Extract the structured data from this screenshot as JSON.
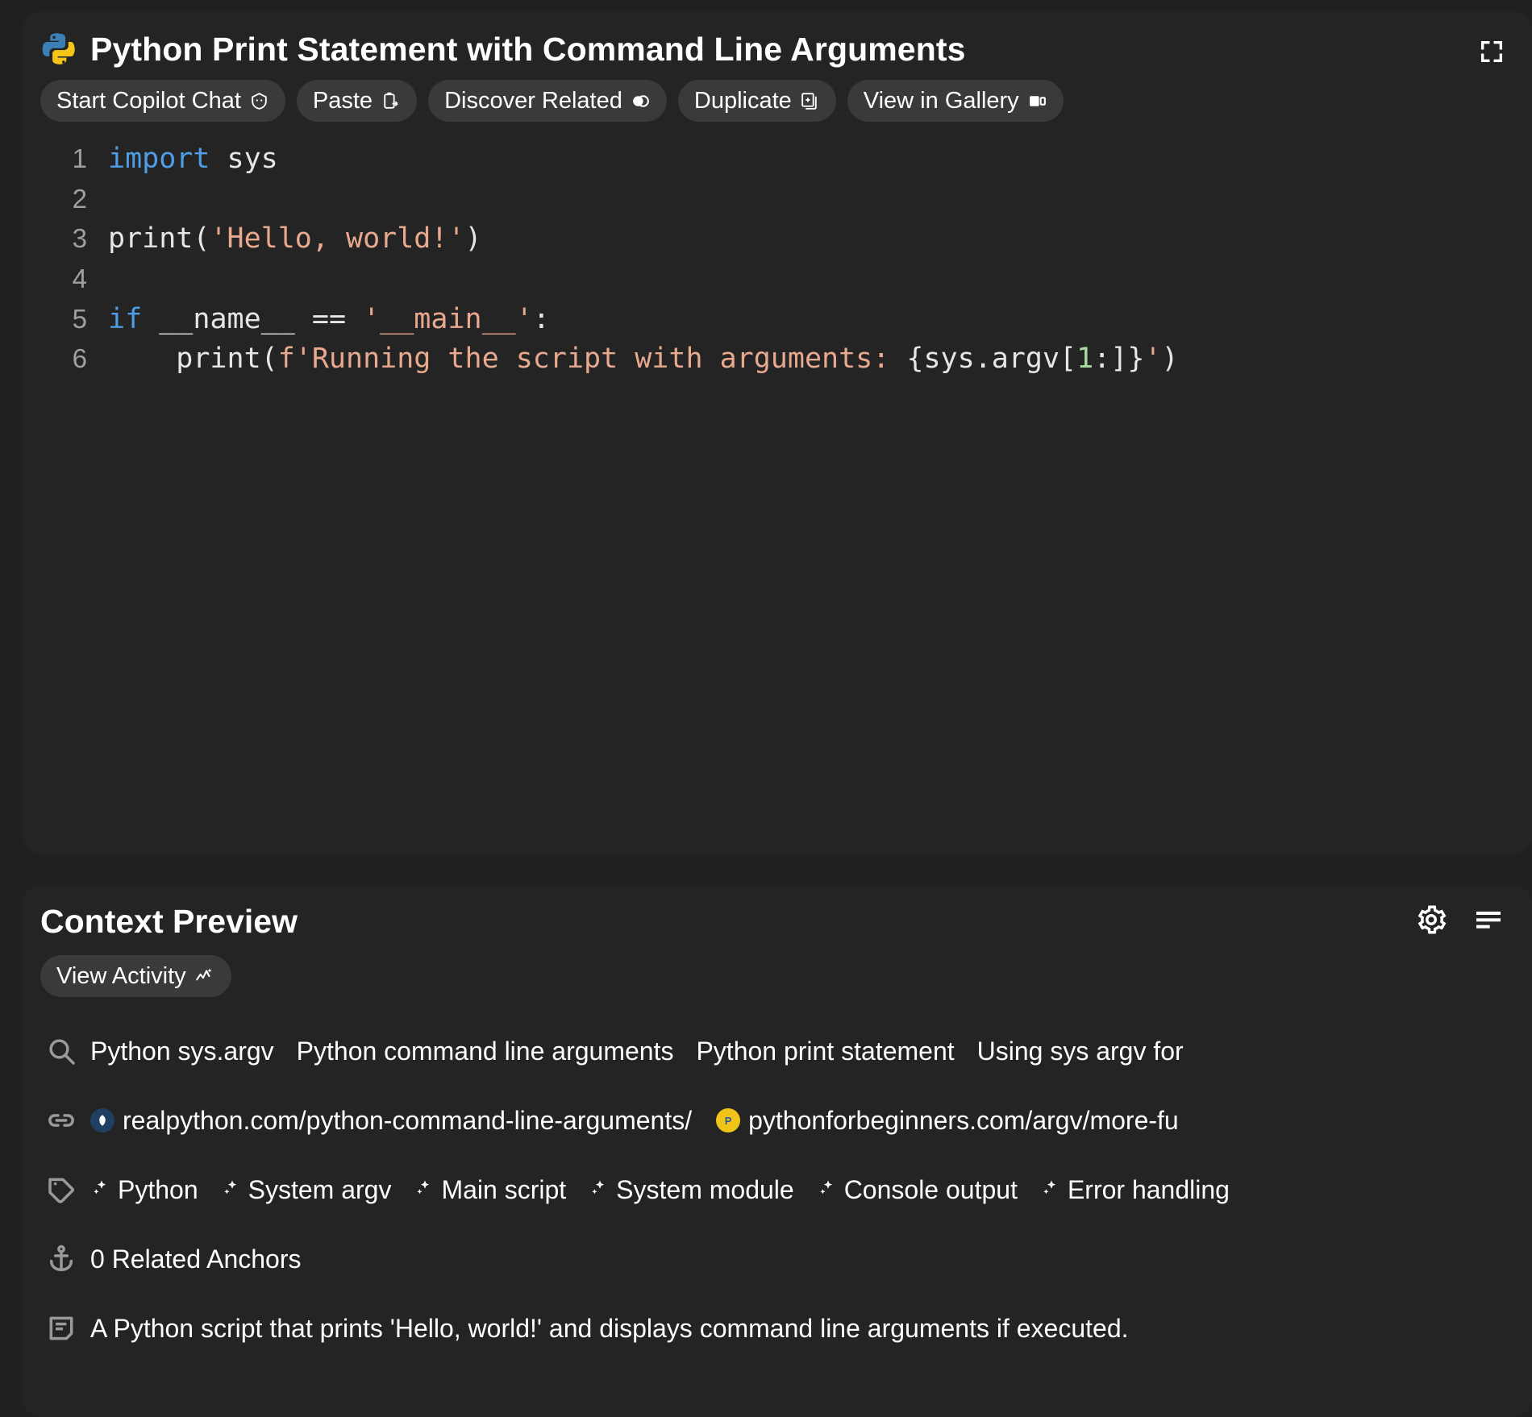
{
  "code_card": {
    "title": "Python Print Statement with Command Line Arguments",
    "logo_icon": "python-logo-icon",
    "expand_icon": "expand-fullscreen-icon",
    "chips": [
      {
        "label": "Start Copilot Chat",
        "icon": "copilot-icon"
      },
      {
        "label": "Paste",
        "icon": "clipboard-paste-icon"
      },
      {
        "label": "Discover Related",
        "icon": "overlapping-circles-icon"
      },
      {
        "label": "Duplicate",
        "icon": "duplicate-window-icon"
      },
      {
        "label": "View in Gallery",
        "icon": "gallery-panel-icon"
      }
    ],
    "language": "python",
    "lines": [
      {
        "n": "1",
        "tokens": [
          {
            "t": "import",
            "c": "kw"
          },
          {
            "t": " sys",
            "c": "pln"
          }
        ]
      },
      {
        "n": "2",
        "tokens": []
      },
      {
        "n": "3",
        "tokens": [
          {
            "t": "print(",
            "c": "pln"
          },
          {
            "t": "'Hello, world!'",
            "c": "str"
          },
          {
            "t": ")",
            "c": "pln"
          }
        ]
      },
      {
        "n": "4",
        "tokens": []
      },
      {
        "n": "5",
        "tokens": [
          {
            "t": "if",
            "c": "kw"
          },
          {
            "t": " __name__ == ",
            "c": "pln"
          },
          {
            "t": "'__main__'",
            "c": "str"
          },
          {
            "t": ":",
            "c": "pln"
          }
        ]
      },
      {
        "n": "6",
        "tokens": [
          {
            "t": "    print(",
            "c": "pln"
          },
          {
            "t": "f'Running the script with arguments: ",
            "c": "str"
          },
          {
            "t": "{sys.argv[",
            "c": "pln"
          },
          {
            "t": "1",
            "c": "num"
          },
          {
            "t": ":]}",
            "c": "pln"
          },
          {
            "t": "'",
            "c": "str"
          },
          {
            "t": ")",
            "c": "pln"
          }
        ]
      }
    ]
  },
  "context_card": {
    "title": "Context Preview",
    "gear_icon": "gear-icon",
    "list_icon": "list-lines-icon",
    "chip": {
      "label": "View Activity",
      "icon": "activity-sparkle-icon"
    },
    "rows": {
      "searches": {
        "icon": "search-icon",
        "items": [
          "Python sys.argv",
          "Python command line arguments",
          "Python print statement",
          "Using sys argv for"
        ]
      },
      "links": {
        "icon": "link-icon",
        "items": [
          {
            "url": "realpython.com/python-command-line-arguments/",
            "favicon": "realpython-favicon"
          },
          {
            "url": "pythonforbeginners.com/argv/more-fu",
            "favicon": "pythonforbeginners-favicon"
          }
        ]
      },
      "tags": {
        "icon": "tag-icon",
        "items": [
          "Python",
          "System argv",
          "Main script",
          "System module",
          "Console output",
          "Error handling"
        ]
      },
      "anchors": {
        "icon": "anchor-icon",
        "text": "0 Related Anchors"
      },
      "description": {
        "icon": "note-icon",
        "text": "A Python script that prints 'Hello, world!' and displays command line arguments if executed."
      }
    }
  },
  "colors": {
    "page_background": "#202020",
    "card_background": "#242424",
    "chip_background": "#3a3a3a",
    "keyword": "#4d9ee6",
    "string": "#e8a98e",
    "number": "#a8dba0",
    "muted_text": "#a0a0a0"
  }
}
